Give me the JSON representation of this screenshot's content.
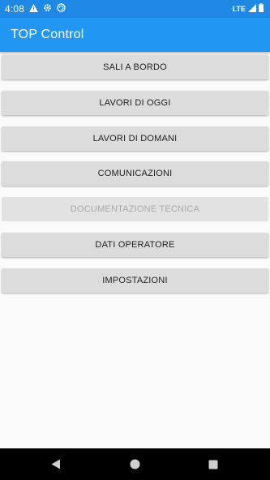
{
  "status_bar": {
    "time": "4:08",
    "network": "LTE",
    "icons": [
      "warning-icon",
      "settings-icon",
      "sync-icon",
      "signal-icon",
      "battery-icon"
    ]
  },
  "app_bar": {
    "title": "TOP Control",
    "color": "#2196f3",
    "status_color": "#1e88e5"
  },
  "menu": {
    "items": [
      {
        "label": "SALI A BORDO",
        "enabled": true
      },
      {
        "label": "LAVORI DI OGGI",
        "enabled": true
      },
      {
        "label": "LAVORI DI DOMANI",
        "enabled": true
      },
      {
        "label": "COMUNICAZIONI",
        "enabled": true
      },
      {
        "label": "DOCUMENTAZIONE TECNICA",
        "enabled": false
      },
      {
        "label": "DATI OPERATORE",
        "enabled": true
      },
      {
        "label": "IMPOSTAZIONI",
        "enabled": true
      }
    ]
  },
  "nav_bar": {
    "icons": [
      "back-icon",
      "home-icon",
      "recents-icon"
    ]
  }
}
